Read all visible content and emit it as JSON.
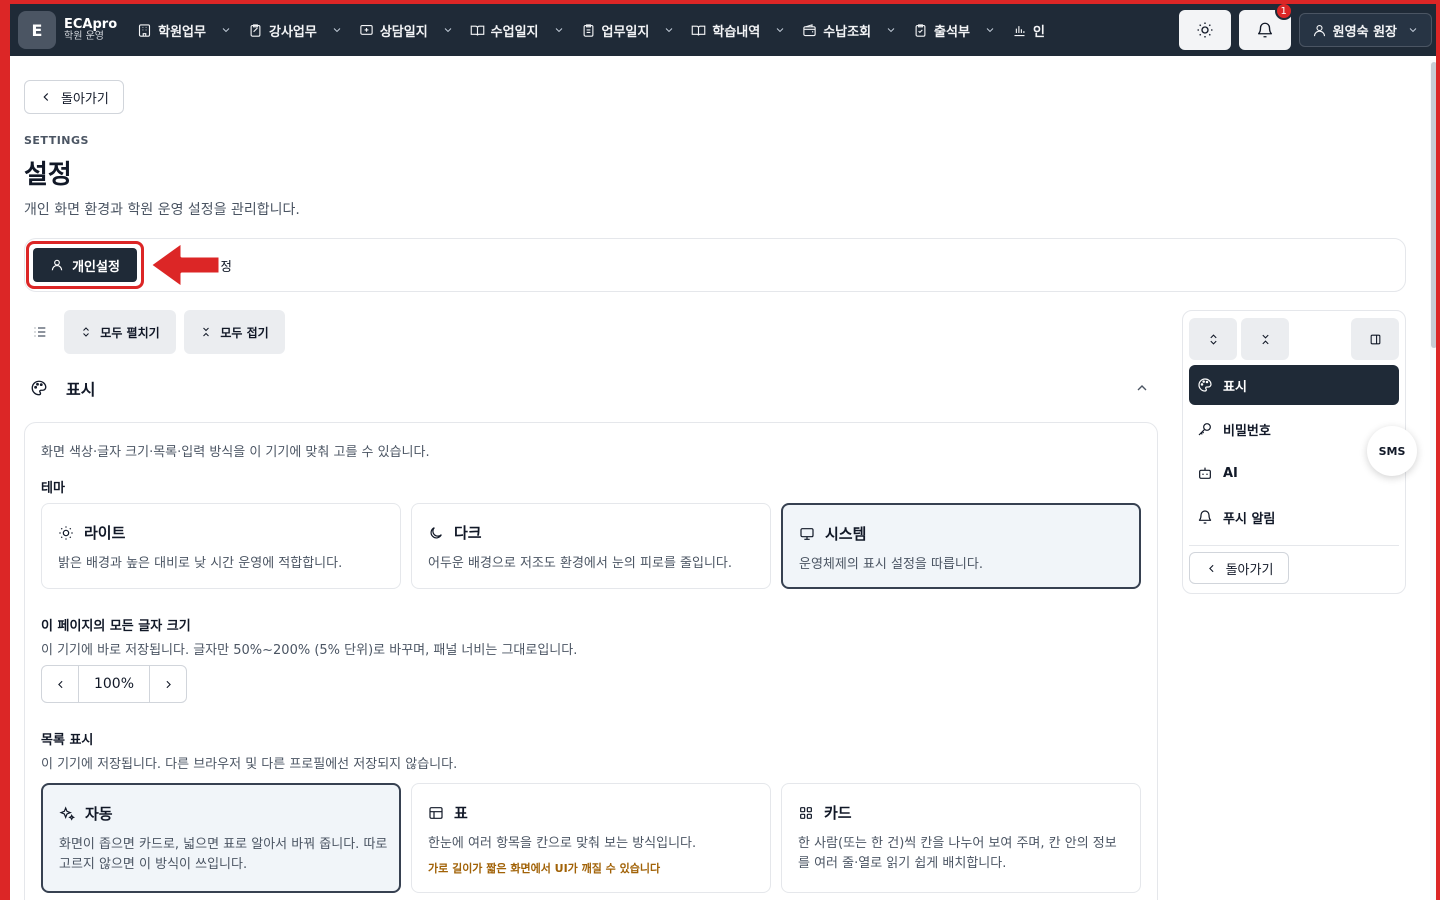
{
  "nav": {
    "logo_letter": "E",
    "brand_name": "ECApro",
    "brand_sub": "학원 운영",
    "items": [
      {
        "label": "학원업무",
        "icon": "building-icon"
      },
      {
        "label": "강사업무",
        "icon": "clipboard-edit-icon"
      },
      {
        "label": "상담일지",
        "icon": "message-plus-icon"
      },
      {
        "label": "수업일지",
        "icon": "book-open-icon"
      },
      {
        "label": "업무일지",
        "icon": "clipboard-list-icon"
      },
      {
        "label": "학습내역",
        "icon": "book-open-icon"
      },
      {
        "label": "수납조회",
        "icon": "wallet-icon"
      },
      {
        "label": "출석부",
        "icon": "clipboard-check-icon"
      },
      {
        "label": "인",
        "icon": "bar-chart-icon"
      }
    ],
    "notification_count": "1",
    "user_label": "원영숙 원장"
  },
  "page": {
    "back_label": "돌아가기",
    "eyebrow": "SETTINGS",
    "title": "설정",
    "description": "개인 화면 환경과 학원 운영 설정을 관리합니다."
  },
  "tabs": {
    "active_label": "개인설정",
    "other_label": "정"
  },
  "toolbar": {
    "expand_all": "모두 펼치기",
    "collapse_all": "모두 접기"
  },
  "section": {
    "title": "표시",
    "description": "화면 색상·글자 크기·목록·입력 방식을 이 기기에 맞춰 고를 수 있습니다."
  },
  "theme": {
    "label": "테마",
    "options": [
      {
        "title": "라이트",
        "desc": "밝은 배경과 높은 대비로 낮 시간 운영에 적합합니다.",
        "icon": "sun-icon"
      },
      {
        "title": "다크",
        "desc": "어두운 배경으로 저조도 환경에서 눈의 피로를 줄입니다.",
        "icon": "moon-icon"
      },
      {
        "title": "시스템",
        "desc": "운영체제의 표시 설정을 따릅니다.",
        "icon": "monitor-icon"
      }
    ],
    "selected": "시스템"
  },
  "font_size": {
    "label": "이 페이지의 모든 글자 크기",
    "desc": "이 기기에 바로 저장됩니다. 글자만 50%~200% (5% 단위)로 바꾸며, 패널 너비는 그대로입니다.",
    "value": "100%"
  },
  "list_view": {
    "label": "목록 표시",
    "desc": "이 기기에 저장됩니다. 다른 브라우저 및 다른 프로필에선 저장되지 않습니다.",
    "options": [
      {
        "title": "자동",
        "desc": "화면이 좁으면 카드로, 넓으면 표로 알아서 바꿔 줍니다. 따로 고르지 않으면 이 방식이 쓰입니다.",
        "icon": "sparkles-icon"
      },
      {
        "title": "표",
        "desc": "한눈에 여러 항목을 칸으로 맞춰 보는 방식입니다.",
        "warning": "가로 길이가 짧은 화면에서 UI가 깨질 수 있습니다",
        "icon": "table-icon"
      },
      {
        "title": "카드",
        "desc": "한 사람(또는 한 건)씩 칸을 나누어 보여 주며, 칸 안의 정보를 여러 줄·열로 읽기 쉽게 배치합니다.",
        "icon": "grid-icon"
      }
    ],
    "selected": "자동"
  },
  "side_nav": {
    "items": [
      {
        "label": "표시",
        "icon": "palette-icon"
      },
      {
        "label": "비밀번호",
        "icon": "key-icon"
      },
      {
        "label": "AI",
        "icon": "bot-icon"
      },
      {
        "label": "푸시 알림",
        "icon": "bell-icon"
      }
    ],
    "back_label": "돌아가기"
  },
  "sms_label": "SMS",
  "colors": {
    "nav_bg": "#1f2a37",
    "accent_red": "#dc2626",
    "active_dark": "#1f2a37"
  }
}
